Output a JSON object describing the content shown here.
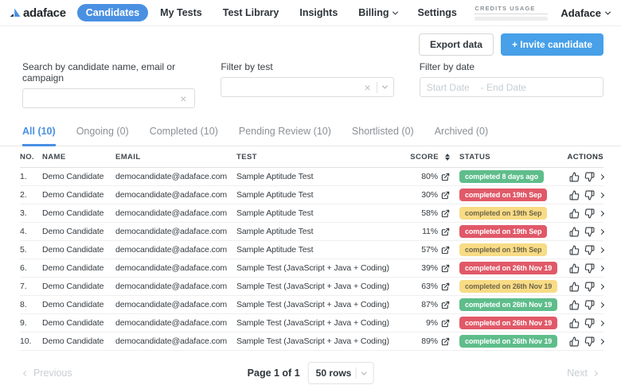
{
  "colors": {
    "accent": "#4a90e2",
    "invite_blue": "#47a0e8",
    "badge_green": "#5ebd8b",
    "badge_red": "#e15968",
    "badge_yellow": "#f8db85"
  },
  "nav": {
    "logo_text": "adaface",
    "items": [
      {
        "label": "Candidates"
      },
      {
        "label": "My Tests"
      },
      {
        "label": "Test Library"
      },
      {
        "label": "Insights"
      },
      {
        "label": "Billing"
      },
      {
        "label": "Settings"
      }
    ],
    "credits_label": "CREDITS USAGE",
    "account_label": "Adaface"
  },
  "toolbar": {
    "export_label": "Export data",
    "invite_label": "+ Invite candidate"
  },
  "filters": {
    "search_label": "Search by candidate name, email or campaign",
    "search_value": "",
    "test_label": "Filter by test",
    "test_value": "",
    "date_label": "Filter by date",
    "date_start_placeholder": "Start Date",
    "date_end_placeholder": "- End Date"
  },
  "tabs": [
    {
      "label": "All (10)"
    },
    {
      "label": "Ongoing (0)"
    },
    {
      "label": "Completed (10)"
    },
    {
      "label": "Pending Review (10)"
    },
    {
      "label": "Shortlisted (0)"
    },
    {
      "label": "Archived (0)"
    }
  ],
  "table": {
    "columns": [
      "NO.",
      "NAME",
      "EMAIL",
      "TEST",
      "SCORE",
      "STATUS",
      "ACTIONS"
    ],
    "rows": [
      {
        "no": "1.",
        "name": "Demo Candidate",
        "email": "democandidate@adaface.com",
        "test": "Sample Aptitude Test",
        "score": "80%",
        "status": "completed 8 days ago",
        "status_color": "green"
      },
      {
        "no": "2.",
        "name": "Demo Candidate",
        "email": "democandidate@adaface.com",
        "test": "Sample Aptitude Test",
        "score": "30%",
        "status": "completed on 19th Sep",
        "status_color": "red"
      },
      {
        "no": "3.",
        "name": "Demo Candidate",
        "email": "democandidate@adaface.com",
        "test": "Sample Aptitude Test",
        "score": "58%",
        "status": "completed on 19th Sep",
        "status_color": "yellow"
      },
      {
        "no": "4.",
        "name": "Demo Candidate",
        "email": "democandidate@adaface.com",
        "test": "Sample Aptitude Test",
        "score": "11%",
        "status": "completed on 19th Sep",
        "status_color": "red"
      },
      {
        "no": "5.",
        "name": "Demo Candidate",
        "email": "democandidate@adaface.com",
        "test": "Sample Aptitude Test",
        "score": "57%",
        "status": "completed on 19th Sep",
        "status_color": "yellow"
      },
      {
        "no": "6.",
        "name": "Demo Candidate",
        "email": "democandidate@adaface.com",
        "test": "Sample Test (JavaScript + Java + Coding)",
        "score": "39%",
        "status": "completed on 26th Nov 19",
        "status_color": "red"
      },
      {
        "no": "7.",
        "name": "Demo Candidate",
        "email": "democandidate@adaface.com",
        "test": "Sample Test (JavaScript + Java + Coding)",
        "score": "63%",
        "status": "completed on 26th Nov 19",
        "status_color": "yellow"
      },
      {
        "no": "8.",
        "name": "Demo Candidate",
        "email": "democandidate@adaface.com",
        "test": "Sample Test (JavaScript + Java + Coding)",
        "score": "87%",
        "status": "completed on 26th Nov 19",
        "status_color": "green"
      },
      {
        "no": "9.",
        "name": "Demo Candidate",
        "email": "democandidate@adaface.com",
        "test": "Sample Test (JavaScript + Java + Coding)",
        "score": "9%",
        "status": "completed on 26th Nov 19",
        "status_color": "red"
      },
      {
        "no": "10.",
        "name": "Demo Candidate",
        "email": "democandidate@adaface.com",
        "test": "Sample Test (JavaScript + Java + Coding)",
        "score": "89%",
        "status": "completed on 26th Nov 19",
        "status_color": "green"
      }
    ]
  },
  "pagination": {
    "previous_label": "Previous",
    "page_info": "Page 1 of 1",
    "rows_select": "50 rows",
    "next_label": "Next"
  }
}
